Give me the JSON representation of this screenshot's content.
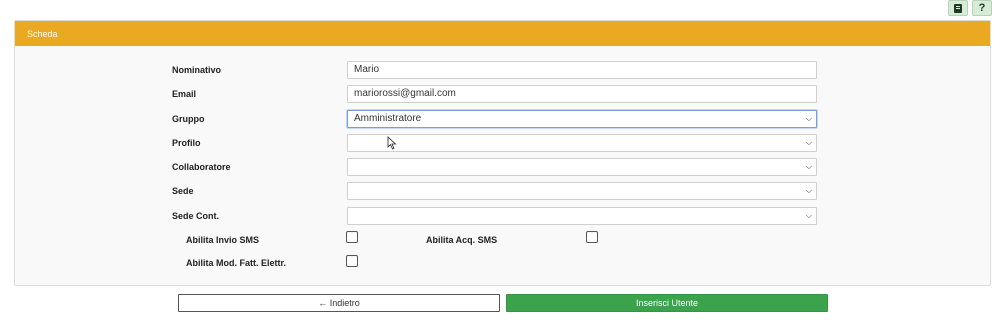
{
  "toolbar": {
    "icon1": "list-icon",
    "icon2_label": "?"
  },
  "panel": {
    "title": "Scheda"
  },
  "form": {
    "nominativo": {
      "label": "Nominativo",
      "value": "Mario"
    },
    "email": {
      "label": "Email",
      "value": "mariorossi@gmail.com"
    },
    "gruppo": {
      "label": "Gruppo",
      "value": "Amministratore"
    },
    "profilo": {
      "label": "Profilo",
      "value": ""
    },
    "collaboratore": {
      "label": "Collaboratore",
      "value": ""
    },
    "sede": {
      "label": "Sede",
      "value": ""
    },
    "sede_cont": {
      "label": "Sede Cont.",
      "value": ""
    },
    "abilita_invio_sms": {
      "label": "Abilita Invio SMS",
      "checked": false
    },
    "abilita_acq_sms": {
      "label": "Abilita Acq. SMS",
      "checked": false
    },
    "abilita_mod_fatt": {
      "label": "Abilita Mod. Fatt. Elettr.",
      "checked": false
    }
  },
  "buttons": {
    "back_label": "← Indietro",
    "insert_label": "Inserisci Utente"
  },
  "colors": {
    "header": "#eaa823",
    "primary": "#3aa34b"
  }
}
